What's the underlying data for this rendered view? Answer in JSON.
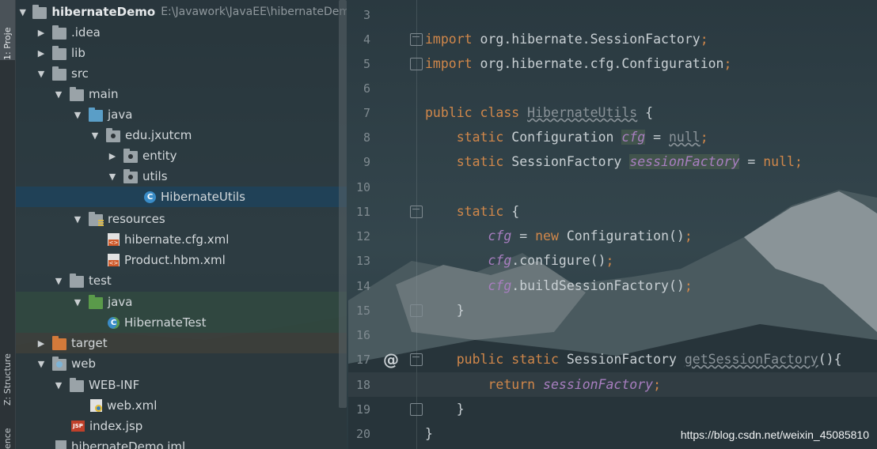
{
  "tool_strip": {
    "project_tab": "1: Proje",
    "structure_tab": "Z: Structure",
    "favorites_tab": "ence"
  },
  "project_tree": {
    "root_name": "hibernateDemo",
    "root_path": "E:\\Javawork\\JavaEE\\hibernateDem",
    "items": [
      {
        "label": ".idea"
      },
      {
        "label": "lib"
      },
      {
        "label": "src"
      },
      {
        "label": "main"
      },
      {
        "label": "java"
      },
      {
        "label": "edu.jxutcm"
      },
      {
        "label": "entity"
      },
      {
        "label": "utils"
      },
      {
        "label": "HibernateUtils"
      },
      {
        "label": "resources"
      },
      {
        "label": "hibernate.cfg.xml"
      },
      {
        "label": "Product.hbm.xml"
      },
      {
        "label": "test"
      },
      {
        "label": "java"
      },
      {
        "label": "HibernateTest"
      },
      {
        "label": "target"
      },
      {
        "label": "web"
      },
      {
        "label": "WEB-INF"
      },
      {
        "label": "web.xml"
      },
      {
        "label": "index.jsp"
      },
      {
        "label": "hibernateDemo.iml"
      }
    ]
  },
  "editor": {
    "line_numbers": [
      "3",
      "4",
      "5",
      "6",
      "7",
      "8",
      "9",
      "10",
      "11",
      "12",
      "13",
      "14",
      "15",
      "16",
      "17",
      "18",
      "19",
      "20"
    ],
    "tokens": {
      "import": "import",
      "pkg1": "org.hibernate.SessionFactory",
      "pkg2": "org.hibernate.cfg.Configuration",
      "semi": ";",
      "public": "public",
      "class": "class",
      "class_name": "HibernateUtils",
      "open_brace": "{",
      "close_brace": "}",
      "static": "static",
      "Configuration": "Configuration",
      "SessionFactory": "SessionFactory",
      "cfg": "cfg",
      "sessionFactory": "sessionFactory",
      "eq": "=",
      "null": "null",
      "new": "new",
      "ctor_call": "Configuration()",
      "configure_call": ".configure()",
      "build_call": ".buildSessionFactory()",
      "getter": "getSessionFactory",
      "parens": "()",
      "return": "return",
      "at": "@"
    }
  },
  "watermark": "https://blog.csdn.net/weixin_45085810"
}
